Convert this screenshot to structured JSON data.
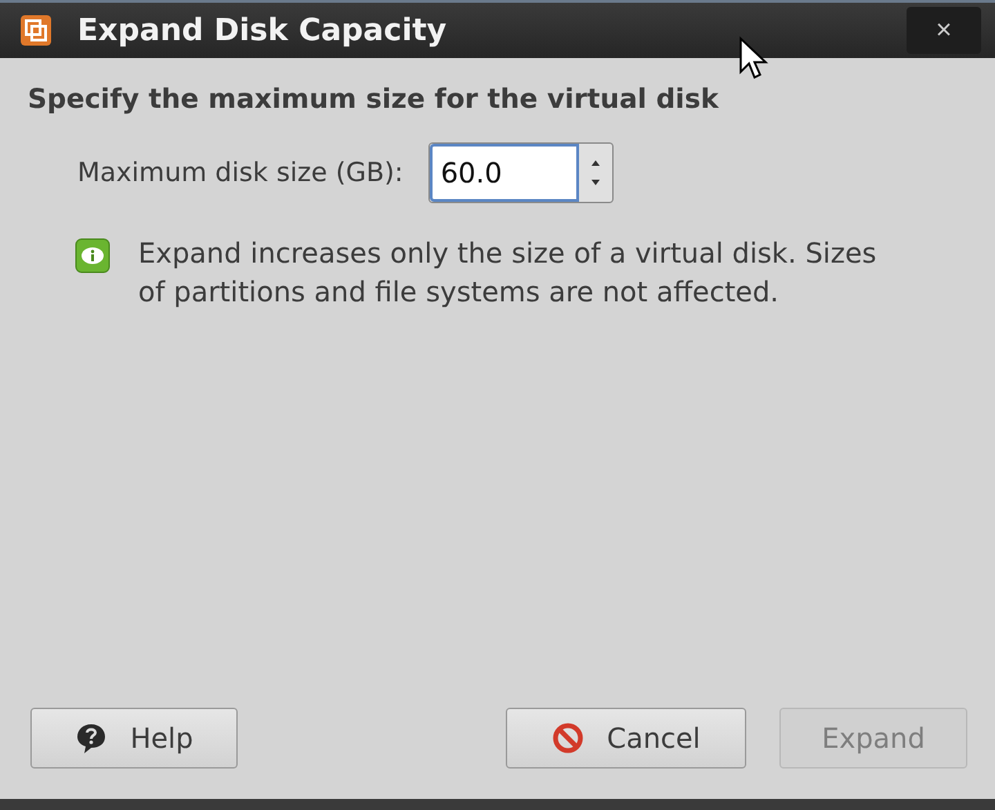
{
  "window": {
    "title": "Expand Disk Capacity",
    "close": "×"
  },
  "heading": "Specify the maximum size for the virtual disk",
  "size_field": {
    "label": "Maximum disk size (GB):",
    "value": "60.0"
  },
  "info": "Expand increases only the size of a virtual disk. Sizes of partitions and file systems are not affected.",
  "buttons": [
    {
      "kind": "help",
      "label": "Help",
      "disabled": false
    },
    {
      "kind": "cancel",
      "label": "Cancel",
      "disabled": false
    },
    {
      "kind": "expand",
      "label": "Expand",
      "disabled": true
    }
  ]
}
